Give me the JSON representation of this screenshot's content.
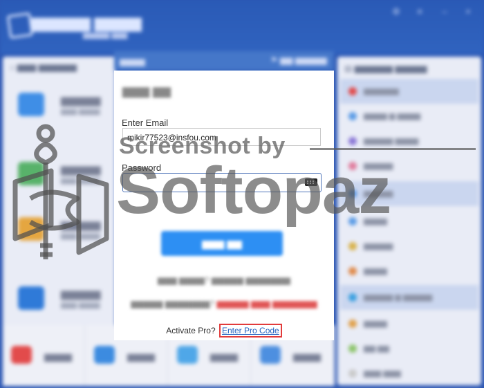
{
  "colors": {
    "titlebar": "#2c57b3",
    "primary_button": "#2d8ff3",
    "link": "#1f5fbf",
    "highlight_border": "#e23b3b",
    "watermark": "#555555"
  },
  "signin": {
    "email_label": "Enter Email",
    "email_value": "mikir77523@insfou.com",
    "password_label": "Password",
    "activate_text": "Activate Pro?",
    "pro_code_link": "Enter Pro Code"
  },
  "watermark": {
    "caption": "Screenshot by",
    "brand": "Softopaz"
  },
  "icons": {
    "keyboard": "keyboard-icon",
    "watermark_logo": "softopaz-logo-icon"
  }
}
